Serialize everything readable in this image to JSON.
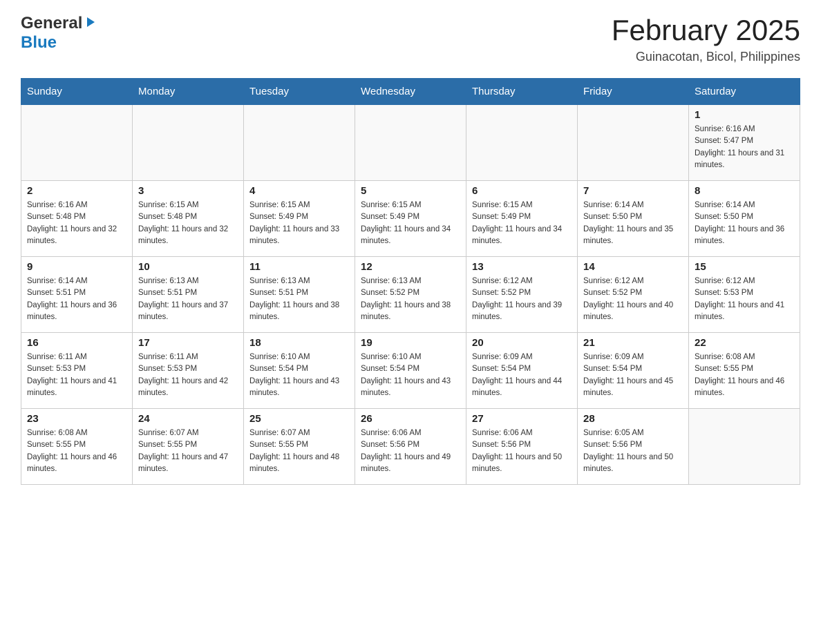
{
  "header": {
    "logo_general": "General",
    "logo_blue": "Blue",
    "month_title": "February 2025",
    "location": "Guinacotan, Bicol, Philippines"
  },
  "days_of_week": [
    "Sunday",
    "Monday",
    "Tuesday",
    "Wednesday",
    "Thursday",
    "Friday",
    "Saturday"
  ],
  "weeks": [
    [
      {
        "day": "",
        "info": ""
      },
      {
        "day": "",
        "info": ""
      },
      {
        "day": "",
        "info": ""
      },
      {
        "day": "",
        "info": ""
      },
      {
        "day": "",
        "info": ""
      },
      {
        "day": "",
        "info": ""
      },
      {
        "day": "1",
        "info": "Sunrise: 6:16 AM\nSunset: 5:47 PM\nDaylight: 11 hours and 31 minutes."
      }
    ],
    [
      {
        "day": "2",
        "info": "Sunrise: 6:16 AM\nSunset: 5:48 PM\nDaylight: 11 hours and 32 minutes."
      },
      {
        "day": "3",
        "info": "Sunrise: 6:15 AM\nSunset: 5:48 PM\nDaylight: 11 hours and 32 minutes."
      },
      {
        "day": "4",
        "info": "Sunrise: 6:15 AM\nSunset: 5:49 PM\nDaylight: 11 hours and 33 minutes."
      },
      {
        "day": "5",
        "info": "Sunrise: 6:15 AM\nSunset: 5:49 PM\nDaylight: 11 hours and 34 minutes."
      },
      {
        "day": "6",
        "info": "Sunrise: 6:15 AM\nSunset: 5:49 PM\nDaylight: 11 hours and 34 minutes."
      },
      {
        "day": "7",
        "info": "Sunrise: 6:14 AM\nSunset: 5:50 PM\nDaylight: 11 hours and 35 minutes."
      },
      {
        "day": "8",
        "info": "Sunrise: 6:14 AM\nSunset: 5:50 PM\nDaylight: 11 hours and 36 minutes."
      }
    ],
    [
      {
        "day": "9",
        "info": "Sunrise: 6:14 AM\nSunset: 5:51 PM\nDaylight: 11 hours and 36 minutes."
      },
      {
        "day": "10",
        "info": "Sunrise: 6:13 AM\nSunset: 5:51 PM\nDaylight: 11 hours and 37 minutes."
      },
      {
        "day": "11",
        "info": "Sunrise: 6:13 AM\nSunset: 5:51 PM\nDaylight: 11 hours and 38 minutes."
      },
      {
        "day": "12",
        "info": "Sunrise: 6:13 AM\nSunset: 5:52 PM\nDaylight: 11 hours and 38 minutes."
      },
      {
        "day": "13",
        "info": "Sunrise: 6:12 AM\nSunset: 5:52 PM\nDaylight: 11 hours and 39 minutes."
      },
      {
        "day": "14",
        "info": "Sunrise: 6:12 AM\nSunset: 5:52 PM\nDaylight: 11 hours and 40 minutes."
      },
      {
        "day": "15",
        "info": "Sunrise: 6:12 AM\nSunset: 5:53 PM\nDaylight: 11 hours and 41 minutes."
      }
    ],
    [
      {
        "day": "16",
        "info": "Sunrise: 6:11 AM\nSunset: 5:53 PM\nDaylight: 11 hours and 41 minutes."
      },
      {
        "day": "17",
        "info": "Sunrise: 6:11 AM\nSunset: 5:53 PM\nDaylight: 11 hours and 42 minutes."
      },
      {
        "day": "18",
        "info": "Sunrise: 6:10 AM\nSunset: 5:54 PM\nDaylight: 11 hours and 43 minutes."
      },
      {
        "day": "19",
        "info": "Sunrise: 6:10 AM\nSunset: 5:54 PM\nDaylight: 11 hours and 43 minutes."
      },
      {
        "day": "20",
        "info": "Sunrise: 6:09 AM\nSunset: 5:54 PM\nDaylight: 11 hours and 44 minutes."
      },
      {
        "day": "21",
        "info": "Sunrise: 6:09 AM\nSunset: 5:54 PM\nDaylight: 11 hours and 45 minutes."
      },
      {
        "day": "22",
        "info": "Sunrise: 6:08 AM\nSunset: 5:55 PM\nDaylight: 11 hours and 46 minutes."
      }
    ],
    [
      {
        "day": "23",
        "info": "Sunrise: 6:08 AM\nSunset: 5:55 PM\nDaylight: 11 hours and 46 minutes."
      },
      {
        "day": "24",
        "info": "Sunrise: 6:07 AM\nSunset: 5:55 PM\nDaylight: 11 hours and 47 minutes."
      },
      {
        "day": "25",
        "info": "Sunrise: 6:07 AM\nSunset: 5:55 PM\nDaylight: 11 hours and 48 minutes."
      },
      {
        "day": "26",
        "info": "Sunrise: 6:06 AM\nSunset: 5:56 PM\nDaylight: 11 hours and 49 minutes."
      },
      {
        "day": "27",
        "info": "Sunrise: 6:06 AM\nSunset: 5:56 PM\nDaylight: 11 hours and 50 minutes."
      },
      {
        "day": "28",
        "info": "Sunrise: 6:05 AM\nSunset: 5:56 PM\nDaylight: 11 hours and 50 minutes."
      },
      {
        "day": "",
        "info": ""
      }
    ]
  ]
}
